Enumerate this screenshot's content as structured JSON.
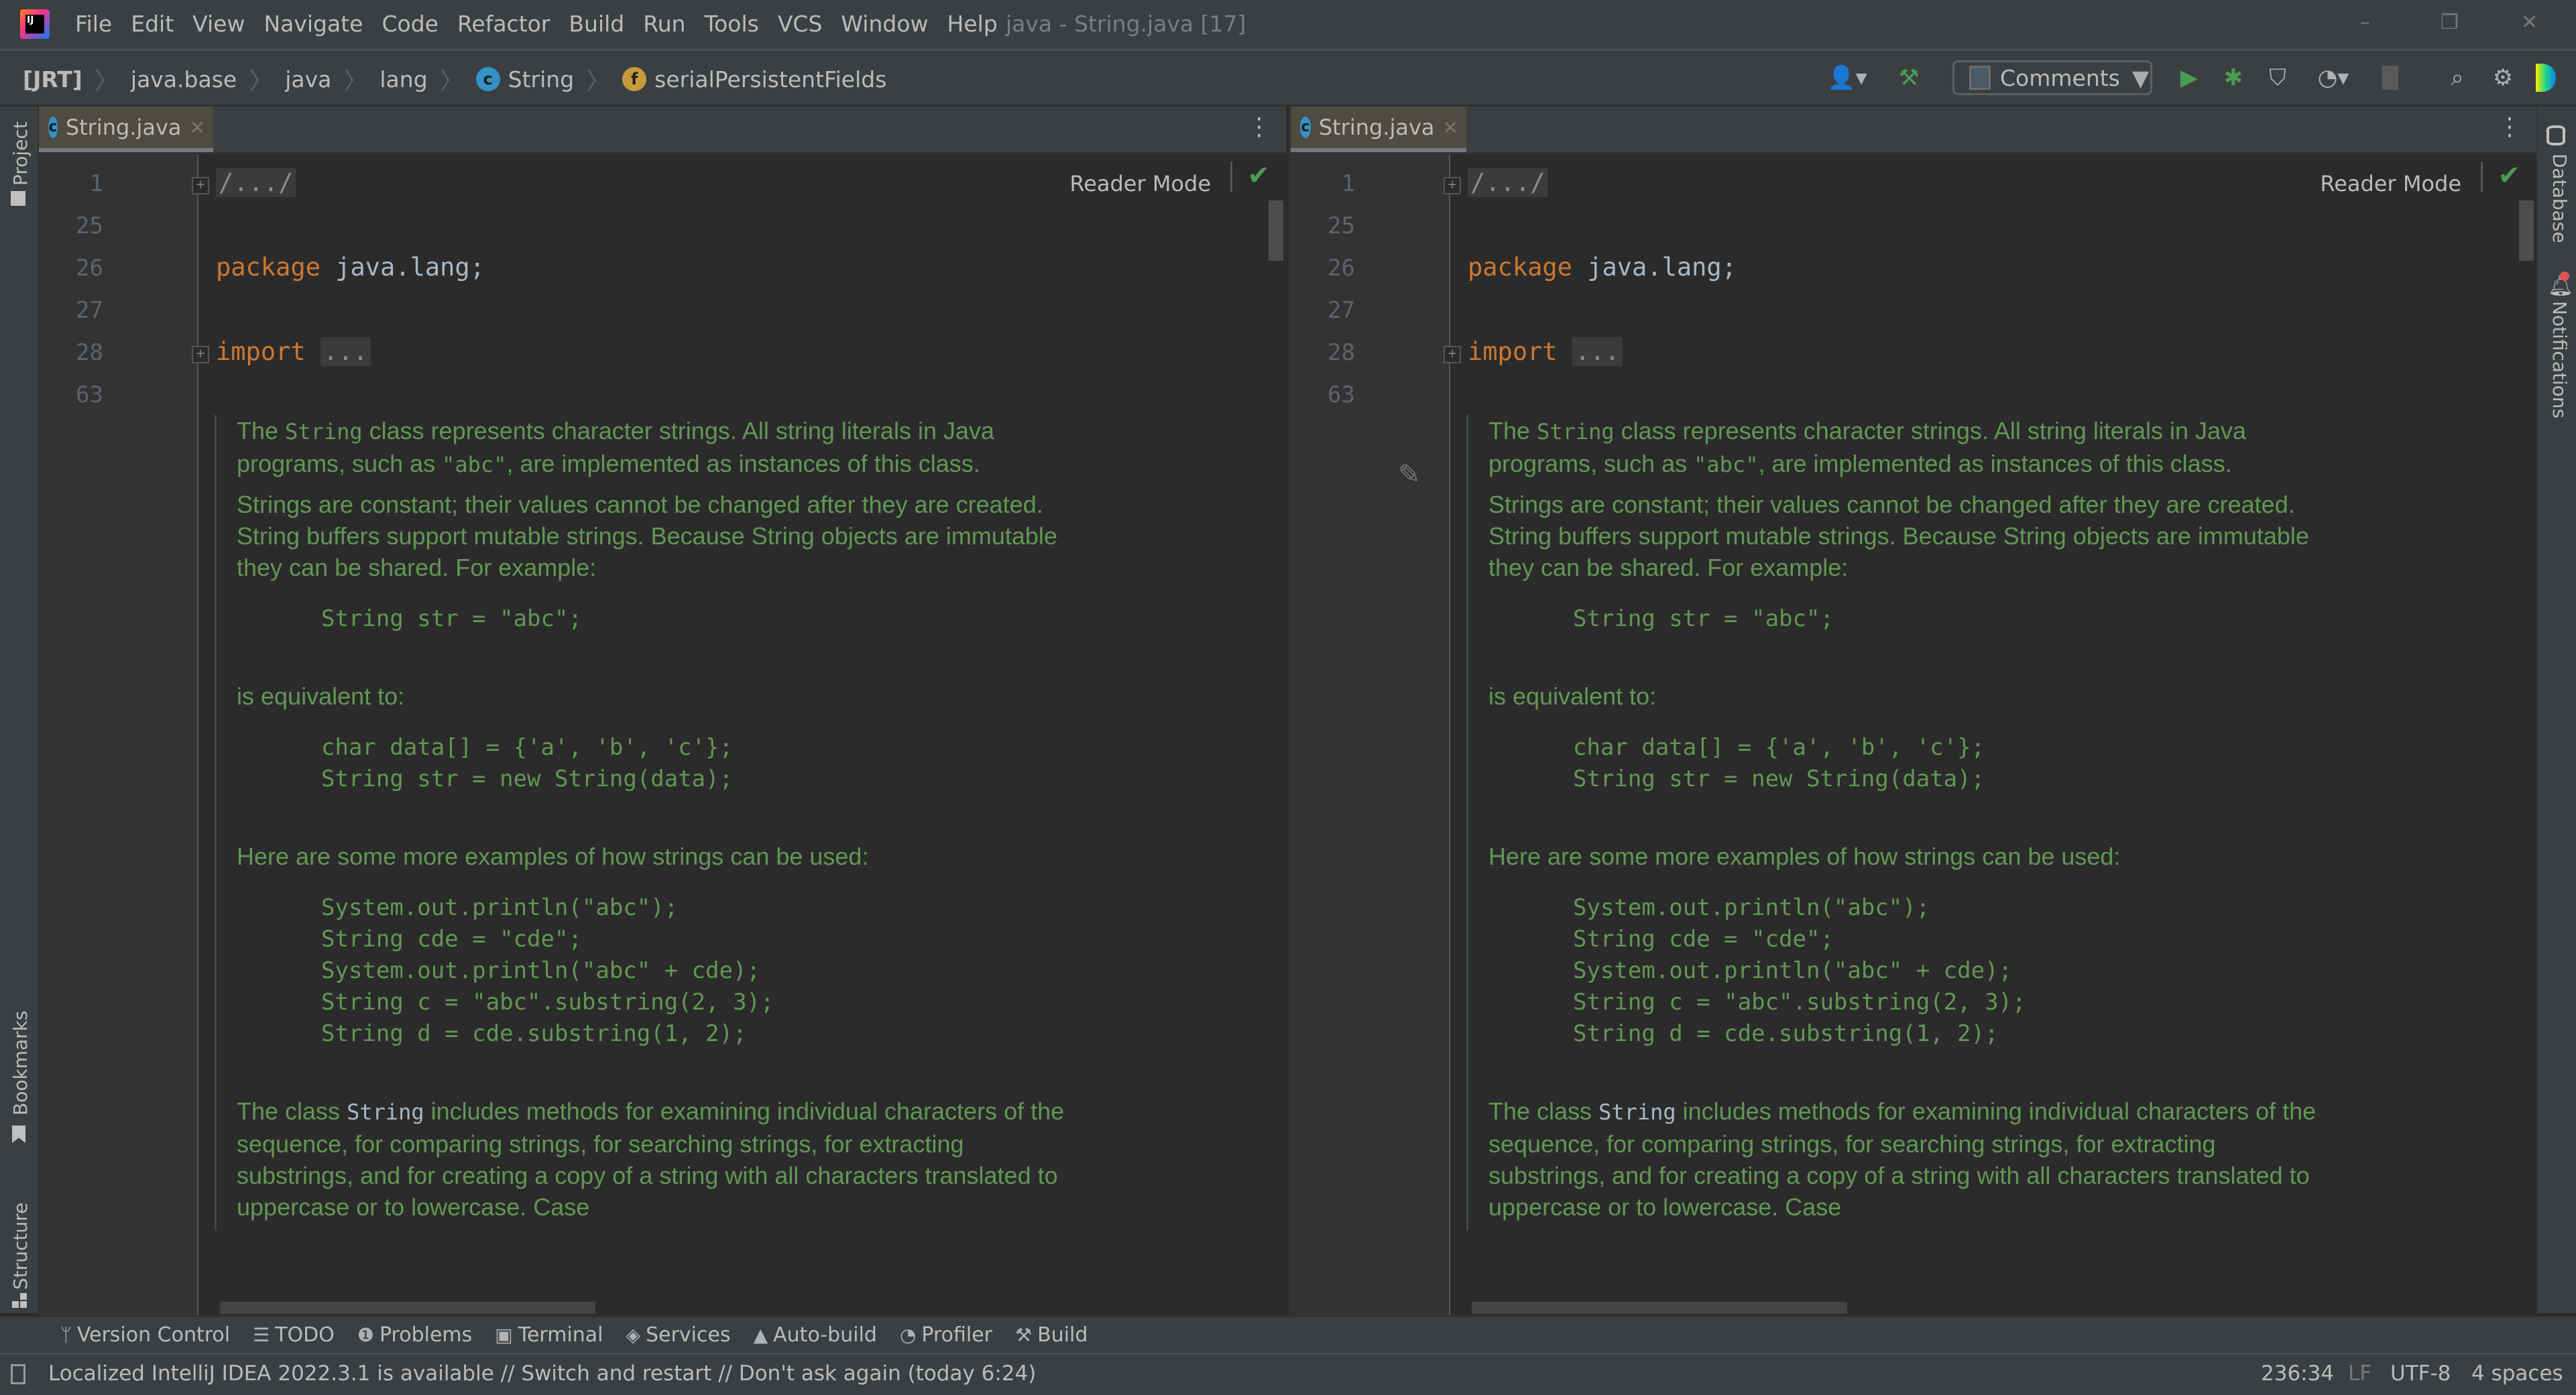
{
  "window": {
    "title": "java - String.java [17]",
    "controls": {
      "minimize": "–",
      "restore": "❐",
      "close": "✕"
    }
  },
  "menu": [
    "File",
    "Edit",
    "View",
    "Navigate",
    "Code",
    "Refactor",
    "Build",
    "Run",
    "Tools",
    "VCS",
    "Window",
    "Help"
  ],
  "breadcrumb": [
    {
      "label": "[JRT]",
      "icon": null
    },
    {
      "label": "java.base",
      "icon": null
    },
    {
      "label": "java",
      "icon": null
    },
    {
      "label": "lang",
      "icon": null
    },
    {
      "label": "String",
      "icon": "class-icon"
    },
    {
      "label": "serialPersistentFields",
      "icon": "field-icon"
    }
  ],
  "toolbar": {
    "run_config": "Comments",
    "colors": {
      "run": "#499c54",
      "class_icon": "#3592c4",
      "field_icon": "#c59b3c"
    }
  },
  "left_stripe": {
    "top": "Project",
    "bookmarks": "Bookmarks",
    "structure": "Structure"
  },
  "right_stripe": {
    "database": "Database",
    "notifications": "Notifications"
  },
  "editors": [
    {
      "tab": "String.java",
      "reader_mode": "Reader Mode",
      "line_numbers": [
        "1",
        "25",
        "26",
        "27",
        "28",
        "63"
      ],
      "code": {
        "line1_fold": "/.../",
        "package_kw": "package",
        "package_name": " java.lang;",
        "import_kw": "import",
        "import_fold": "..."
      }
    },
    {
      "tab": "String.java",
      "reader_mode": "Reader Mode",
      "line_numbers": [
        "1",
        "25",
        "26",
        "27",
        "28",
        "63"
      ],
      "code": {
        "line1_fold": "/.../",
        "package_kw": "package",
        "package_name": " java.lang;",
        "import_kw": "import",
        "import_fold": "..."
      }
    }
  ],
  "javadoc": {
    "p1_a": "The ",
    "p1_mono": "String",
    "p1_b": " class represents character strings. All string literals in Java programs, such as ",
    "p1_mono2": "\"abc\"",
    "p1_c": ", are implemented as instances of this class.",
    "p2": "Strings are constant; their values cannot be changed after they are created. String buffers support mutable strings. Because String objects are immutable they can be shared. For example:",
    "code1": "String str = \"abc\";",
    "p3": "is equivalent to:",
    "code2": "char data[] = {'a', 'b', 'c'};\nString str = new String(data);",
    "p4": "Here are some more examples of how strings can be used:",
    "code3": "System.out.println(\"abc\");\nString cde = \"cde\";\nSystem.out.println(\"abc\" + cde);\nString c = \"abc\".substring(2, 3);\nString d = cde.substring(1, 2);",
    "p5_a": "The class ",
    "p5_ref": "String",
    "p5_b": " includes methods for examining individual characters of the sequence, for comparing strings, for searching strings, for extracting substrings, and for creating a copy of a string with all characters translated to uppercase or to lowercase. Case"
  },
  "tool_windows": [
    {
      "label": "Version Control",
      "icon": "branch-icon"
    },
    {
      "label": "TODO",
      "icon": "list-icon"
    },
    {
      "label": "Problems",
      "icon": "problems-icon"
    },
    {
      "label": "Terminal",
      "icon": "terminal-icon"
    },
    {
      "label": "Services",
      "icon": "services-icon"
    },
    {
      "label": "Auto-build",
      "icon": "warning-icon"
    },
    {
      "label": "Profiler",
      "icon": "profiler-icon"
    },
    {
      "label": "Build",
      "icon": "hammer-icon"
    }
  ],
  "status": {
    "message": "Localized IntelliJ IDEA 2022.3.1 is available // Switch and restart // Don't ask again (today 6:24)",
    "position": "236:34",
    "line_sep": "LF",
    "encoding": "UTF-8",
    "indent": "4 spaces"
  }
}
